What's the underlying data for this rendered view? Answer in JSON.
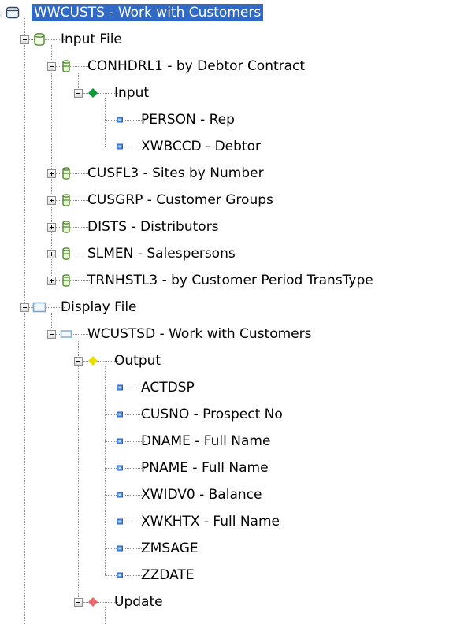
{
  "colors": {
    "selection": "#316ac5",
    "db_icon": "#3a8a3a",
    "input_diamond": "#0a9a3a",
    "output_diamond": "#e8e000",
    "update_diamond": "#e86a6a",
    "field_square": "#3c78d8",
    "display_icon": "#8ab0d8"
  },
  "tree": [
    {
      "id": "root",
      "level": 0,
      "label": "WWCUSTS - Work with Customers",
      "icon": "program-icon",
      "toggle": "minus",
      "selected": true
    },
    {
      "id": "input-file",
      "level": 1,
      "label": "Input File",
      "icon": "database-icon",
      "toggle": "minus"
    },
    {
      "id": "conhdrl1",
      "level": 2,
      "label": "CONHDRL1 - by Debtor Contract",
      "icon": "file-cylinder-icon",
      "toggle": "minus"
    },
    {
      "id": "input",
      "level": 3,
      "label": "Input",
      "icon": "green-diamond-icon",
      "toggle": "minus"
    },
    {
      "id": "person",
      "level": 4,
      "label": "PERSON - Rep",
      "icon": "field-icon",
      "toggle": "none"
    },
    {
      "id": "xwbccd",
      "level": 4,
      "label": "XWBCCD - Debtor",
      "icon": "field-icon",
      "toggle": "none"
    },
    {
      "id": "cusfl3",
      "level": 2,
      "label": "CUSFL3 - Sites by Number",
      "icon": "file-cylinder-icon",
      "toggle": "plus"
    },
    {
      "id": "cusgrp",
      "level": 2,
      "label": "CUSGRP - Customer Groups",
      "icon": "file-cylinder-icon",
      "toggle": "plus"
    },
    {
      "id": "dists",
      "level": 2,
      "label": "DISTS - Distributors",
      "icon": "file-cylinder-icon",
      "toggle": "plus"
    },
    {
      "id": "slmen",
      "level": 2,
      "label": "SLMEN - Salespersons",
      "icon": "file-cylinder-icon",
      "toggle": "plus"
    },
    {
      "id": "trnhstl3",
      "level": 2,
      "label": "TRNHSTL3 - by Customer Period TransType",
      "icon": "file-cylinder-icon",
      "toggle": "plus"
    },
    {
      "id": "display-file",
      "level": 1,
      "label": "Display File",
      "icon": "display-icon",
      "toggle": "minus"
    },
    {
      "id": "wcustsd",
      "level": 2,
      "label": "WCUSTSD - Work with Customers",
      "icon": "display-format-icon",
      "toggle": "minus"
    },
    {
      "id": "output",
      "level": 3,
      "label": "Output",
      "icon": "yellow-diamond-icon",
      "toggle": "minus"
    },
    {
      "id": "actdsp",
      "level": 4,
      "label": "ACTDSP",
      "icon": "field-icon",
      "toggle": "none"
    },
    {
      "id": "cusno",
      "level": 4,
      "label": "CUSNO - Prospect No",
      "icon": "field-icon",
      "toggle": "none"
    },
    {
      "id": "dname",
      "level": 4,
      "label": "DNAME - Full Name",
      "icon": "field-icon",
      "toggle": "none"
    },
    {
      "id": "pname",
      "level": 4,
      "label": "PNAME - Full Name",
      "icon": "field-icon",
      "toggle": "none"
    },
    {
      "id": "xwidv0",
      "level": 4,
      "label": "XWIDV0 - Balance",
      "icon": "field-icon",
      "toggle": "none"
    },
    {
      "id": "xwkhtx",
      "level": 4,
      "label": "XWKHTX - Full Name",
      "icon": "field-icon",
      "toggle": "none"
    },
    {
      "id": "zmsage",
      "level": 4,
      "label": "ZMSAGE",
      "icon": "field-icon",
      "toggle": "none"
    },
    {
      "id": "zzdate",
      "level": 4,
      "label": "ZZDATE",
      "icon": "field-icon",
      "toggle": "none"
    },
    {
      "id": "update",
      "level": 3,
      "label": "Update",
      "icon": "red-diamond-icon",
      "toggle": "minus"
    }
  ]
}
